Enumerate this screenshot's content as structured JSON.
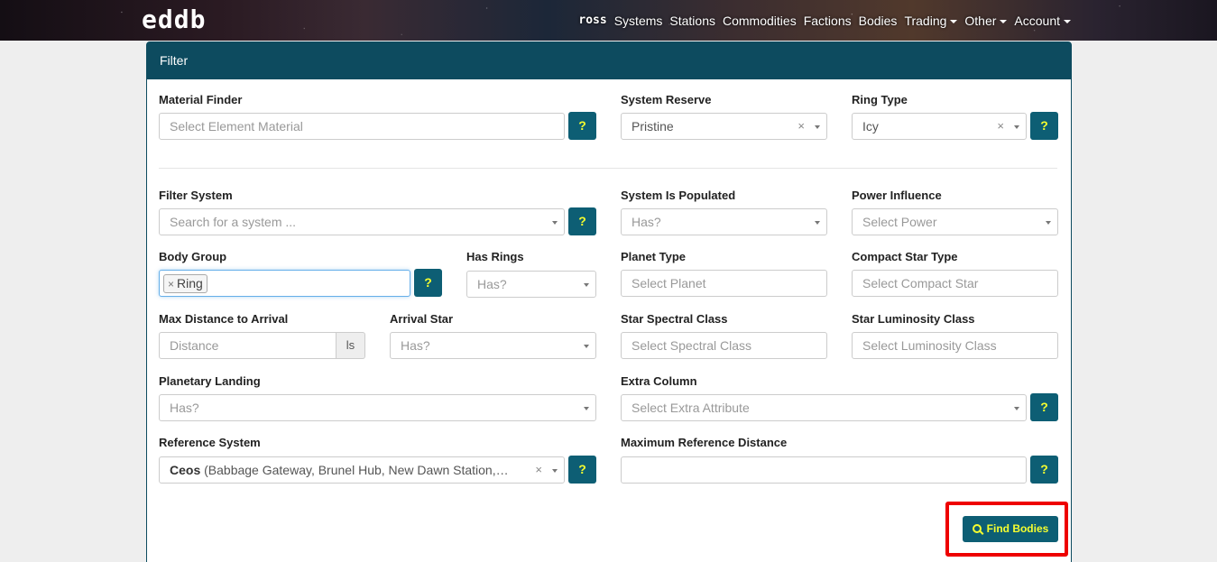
{
  "brand": "eddb",
  "nav": {
    "items": [
      {
        "label": "ross"
      },
      {
        "label": "Systems"
      },
      {
        "label": "Stations"
      },
      {
        "label": "Commodities"
      },
      {
        "label": "Factions"
      },
      {
        "label": "Bodies"
      },
      {
        "label": "Trading"
      },
      {
        "label": "Other"
      },
      {
        "label": "Account"
      }
    ]
  },
  "panel": {
    "title": "Filter"
  },
  "help_label": "?",
  "fields": {
    "material_finder": {
      "label": "Material Finder",
      "placeholder": "Select Element Material"
    },
    "system_reserve": {
      "label": "System Reserve",
      "value": "Pristine"
    },
    "ring_type": {
      "label": "Ring Type",
      "value": "Icy"
    },
    "filter_system": {
      "label": "Filter System",
      "placeholder": "Search for a system ..."
    },
    "system_is_populated": {
      "label": "System Is Populated",
      "placeholder": "Has?"
    },
    "power_influence": {
      "label": "Power Influence",
      "placeholder": "Select Power"
    },
    "body_group": {
      "label": "Body Group",
      "tag": "Ring"
    },
    "has_rings": {
      "label": "Has Rings",
      "placeholder": "Has?"
    },
    "planet_type": {
      "label": "Planet Type",
      "placeholder": "Select Planet"
    },
    "compact_star_type": {
      "label": "Compact Star Type",
      "placeholder": "Select Compact Star"
    },
    "max_distance": {
      "label": "Max Distance to Arrival",
      "placeholder": "Distance",
      "unit": "ls"
    },
    "arrival_star": {
      "label": "Arrival Star",
      "placeholder": "Has?"
    },
    "star_spectral_class": {
      "label": "Star Spectral Class",
      "placeholder": "Select Spectral Class"
    },
    "star_luminosity_class": {
      "label": "Star Luminosity Class",
      "placeholder": "Select Luminosity Class"
    },
    "planetary_landing": {
      "label": "Planetary Landing",
      "placeholder": "Has?"
    },
    "extra_column": {
      "label": "Extra Column",
      "placeholder": "Select Extra Attribute"
    },
    "reference_system": {
      "label": "Reference System",
      "value_name": "Ceos",
      "value_detail": "(Babbage Gateway, Brunel Hub, New Dawn Station,…"
    },
    "max_reference_distance": {
      "label": "Maximum Reference Distance",
      "value": ""
    }
  },
  "find_button": {
    "label": "Find Bodies"
  }
}
